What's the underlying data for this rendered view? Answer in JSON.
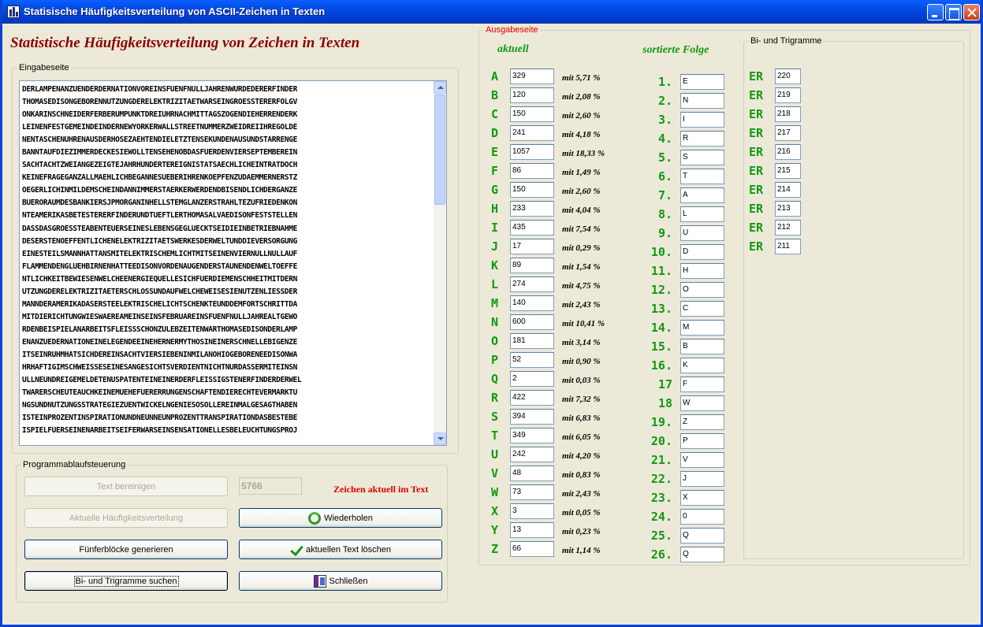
{
  "window": {
    "title": "Statisische Häufigkeitsverteilung von ASCII-Zeichen in Texten"
  },
  "main_heading": "Statistische Häufigkeitsverteilung von Zeichen in Texten",
  "input": {
    "legend": "Eingabeseite",
    "lines": [
      "DERLAMPENANZUENDERDERNATIONVOREINSFUENFNULLJAHRENWURDEDERERFINDER",
      "THOMASEDISONGEBORENNUTZUNGDERELEKTRIZITAETWARSEINGROESSTERERFOLGV",
      "ONKARINSCHNEIDERFERBERUMPUNKTDREIUHRNACHMITTAGSZOGENDIEHERRENDERK",
      "LEINENFESTGEMEINDEINDERNEWYORKERWALLSTREETNUMMERZWEIDREIIHREGOLDE",
      "NENTASCHENUHRENAUSDERHOSEZAEHTENDIELETZTENSEKUNDENAUSUNDSTARRENGE",
      "BANNTAUFDIEZIMMERDECKESIEWOLLTENSEHENOBDASFUERDENVIERSEPTEMBEREIN",
      "SACHTACHTZWEIANGEZEIGTEJAHRHUNDERTEREIGNISTATSAECHLICHEINTRATDOCH",
      "KEINEFRAGEGANZALLMAEHLICHBEGANNESUEBERIHRENKOEPFENZUDAEMMERNERSTZ",
      "OEGERLICHINMILDEMSCHEINDANNIMMERSTAERKERWERDENDBISENDLICHDERGANZE",
      "BUERORAUMDESBANKIERSJPMORGANINHELLSTEMGLANZERSTRAHLTEZUFRIEDENKON",
      "NTEAMERIKASBETESTERERFINDERUNDTUEFTLERTHOMASALVAEDISONFESTSTELLEN",
      "DASSDASGROESSTEABENTEUERSEINESLEBENSGEGLUECKTSEIDIEINBETRIEBNAHME",
      "DESERSTENOEFFENTLICHENELEKTRIZITAETSWERKESDERWELTUNDDIEVERSORGUNG",
      "EINESTEILSMANNHATTANSMITELEKTRISCHEMLICHTMITSEINENVIERNULLNULLAUF",
      "FLAMMENDENGLUEHBIRNENHATTEEDISONVORDENAUGENDERSTAUNENDENWELTOEFFE",
      "NTLICHKEITBEWIESENWELCHEENERGIEQUELLESICHFUERDIEMENSCHHEITMITDERN",
      "UTZUNGDERELEKTRIZITAETERSCHLOSSUNDAUFWELCHEWEISESIENUTZENLIESSDER",
      "MANNDERAMERIKADASERSTEELEKTRISCHELICHTSCHENKTEUNDDEMFORTSCHRITTDA",
      "MITDIERICHTUNGWIESWAEREAMEINSEINSFEBRUAREINSFUENFNULLJAHREALTGEWO",
      "RDENBEISPIELANARBEITSFLEISSSCHONZULEBZEITENWARTHOMASEDISONDERLAMP",
      "ENANZUEDERNATIONEINELEGENDEEINEHERNERMYTHOSINEINERSCHNELLEBIGENZE",
      "ITSEINRUHMHATSICHDEREINSACHTVIERSIEBENINMILANOHIOGEBORENEEDISONWA",
      "HRHAFTIGIMSCHWEISSESEINESANGESICHTSVERDIENTNICHTNURDASSERMITEINSN",
      "ULLNEUNDREIGEMELDETENUSPATENTEINEINERDERFLEISSIGSTENERFINDERDERWEL",
      "TWARERSCHEUTEAUCHKEINEMUEHEFUERERRUNGENSCHAFTENDIERECHTEVERMARKTU",
      "NGSUNDNUTZUNGSSTRATEGIEZUENTWICKELNGENIESOSOLLEREINMALGESAGTHABEN",
      "ISTEINPROZENTINSPIRATIONUNDNEUNNEUNPROZENTTRANSPIRATIONDASBESTEBE",
      "ISPIELFUERSEINENARBEITSEIFERWARSEINSENSATIONELLESBELEUCHTUNGSPROJ"
    ]
  },
  "control": {
    "legend": "Programmablaufsteuerung",
    "btn_clean": "Text bereinigen",
    "char_count": "5766",
    "char_count_label": "Zeichen aktuell im Text",
    "btn_current_distribution": "Aktuelle Häufigkeitsverteilung",
    "btn_repeat": "Wiederholen",
    "btn_five_blocks": "Fünferblöcke generieren",
    "btn_delete_text": "aktuellen Text löschen",
    "btn_search_bigrams": "Bi- und Trigramme suchen",
    "btn_close": "Schließen"
  },
  "output": {
    "legend": "Ausgabeseite",
    "header_current": "aktuell",
    "header_sorted": "sortierte Folge",
    "frequencies": [
      {
        "letter": "A",
        "count": "329",
        "pct": "mit 5,71 %"
      },
      {
        "letter": "B",
        "count": "120",
        "pct": "mit 2,08 %"
      },
      {
        "letter": "C",
        "count": "150",
        "pct": "mit 2,60 %"
      },
      {
        "letter": "D",
        "count": "241",
        "pct": "mit 4,18 %"
      },
      {
        "letter": "E",
        "count": "1057",
        "pct": "mit 18,33 %"
      },
      {
        "letter": "F",
        "count": "86",
        "pct": "mit 1,49 %"
      },
      {
        "letter": "G",
        "count": "150",
        "pct": "mit 2,60 %"
      },
      {
        "letter": "H",
        "count": "233",
        "pct": "mit 4,04 %"
      },
      {
        "letter": "I",
        "count": "435",
        "pct": "mit 7,54 %"
      },
      {
        "letter": "J",
        "count": "17",
        "pct": "mit 0,29 %"
      },
      {
        "letter": "K",
        "count": "89",
        "pct": "mit 1,54 %"
      },
      {
        "letter": "L",
        "count": "274",
        "pct": "mit 4,75 %"
      },
      {
        "letter": "M",
        "count": "140",
        "pct": "mit 2,43 %"
      },
      {
        "letter": "N",
        "count": "600",
        "pct": "mit 10,41 %"
      },
      {
        "letter": "O",
        "count": "181",
        "pct": "mit 3,14 %"
      },
      {
        "letter": "P",
        "count": "52",
        "pct": "mit 0,90 %"
      },
      {
        "letter": "Q",
        "count": "2",
        "pct": "mit 0,03 %"
      },
      {
        "letter": "R",
        "count": "422",
        "pct": "mit 7,32 %"
      },
      {
        "letter": "S",
        "count": "394",
        "pct": "mit 6,83 %"
      },
      {
        "letter": "T",
        "count": "349",
        "pct": "mit 6,05 %"
      },
      {
        "letter": "U",
        "count": "242",
        "pct": "mit 4,20 %"
      },
      {
        "letter": "V",
        "count": "48",
        "pct": "mit 0,83 %"
      },
      {
        "letter": "W",
        "count": "73",
        "pct": "mit 2,43 %"
      },
      {
        "letter": "X",
        "count": "3",
        "pct": "mit 0,05 %"
      },
      {
        "letter": "Y",
        "count": "13",
        "pct": "mit 0,23 %"
      },
      {
        "letter": "Z",
        "count": "66",
        "pct": "mit 1,14 %"
      }
    ],
    "sorted": [
      {
        "rank": "1.",
        "letter": "E"
      },
      {
        "rank": "2.",
        "letter": "N"
      },
      {
        "rank": "3.",
        "letter": "I"
      },
      {
        "rank": "4.",
        "letter": "R"
      },
      {
        "rank": "5.",
        "letter": "S"
      },
      {
        "rank": "6.",
        "letter": "T"
      },
      {
        "rank": "7.",
        "letter": "A"
      },
      {
        "rank": "8.",
        "letter": "L"
      },
      {
        "rank": "9.",
        "letter": "U"
      },
      {
        "rank": "10.",
        "letter": "D"
      },
      {
        "rank": "11.",
        "letter": "H"
      },
      {
        "rank": "12.",
        "letter": "O"
      },
      {
        "rank": "13.",
        "letter": "C"
      },
      {
        "rank": "14.",
        "letter": "M"
      },
      {
        "rank": "15.",
        "letter": "B"
      },
      {
        "rank": "16.",
        "letter": "K"
      },
      {
        "rank": "17",
        "letter": "F"
      },
      {
        "rank": "18",
        "letter": "W"
      },
      {
        "rank": "19.",
        "letter": "Z"
      },
      {
        "rank": "20.",
        "letter": "P"
      },
      {
        "rank": "21.",
        "letter": "V"
      },
      {
        "rank": "22.",
        "letter": "J"
      },
      {
        "rank": "23.",
        "letter": "X"
      },
      {
        "rank": "24.",
        "letter": "0"
      },
      {
        "rank": "25.",
        "letter": "Q"
      },
      {
        "rank": "26.",
        "letter": "Q"
      }
    ]
  },
  "bigrams": {
    "legend": "Bi- und Trigramme",
    "rows": [
      {
        "gram": "ER",
        "count": "220"
      },
      {
        "gram": "ER",
        "count": "219"
      },
      {
        "gram": "ER",
        "count": "218"
      },
      {
        "gram": "ER",
        "count": "217"
      },
      {
        "gram": "ER",
        "count": "216"
      },
      {
        "gram": "ER",
        "count": "215"
      },
      {
        "gram": "ER",
        "count": "214"
      },
      {
        "gram": "ER",
        "count": "213"
      },
      {
        "gram": "ER",
        "count": "212"
      },
      {
        "gram": "ER",
        "count": "211"
      }
    ]
  },
  "colors": {
    "heading": "#8b0000",
    "green_text": "#119911",
    "red_label": "#e00000",
    "titlebar": "#0249e0"
  }
}
